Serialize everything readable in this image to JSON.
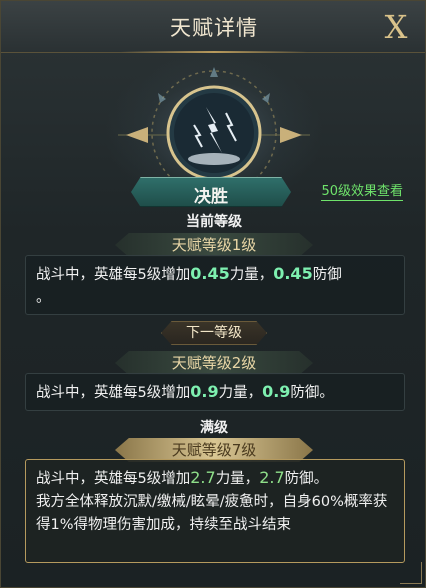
{
  "header": {
    "title": "天赋详情",
    "close_label": "X"
  },
  "talent": {
    "name": "决胜",
    "lv50_link": "50级效果查看"
  },
  "current": {
    "section_label": "当前等级",
    "level_label": "天赋等级1级",
    "desc": [
      "战斗中，英雄每5级增加",
      "0.45",
      "力量，",
      "0.45",
      "防御",
      "。"
    ]
  },
  "next": {
    "section_label": "下一等级",
    "level_label": "天赋等级2级",
    "desc": [
      "战斗中，英雄每5级增加",
      "0.9",
      "力量，",
      "0.9",
      "防御。"
    ]
  },
  "max": {
    "section_label": "满级",
    "level_label": "天赋等级7级",
    "desc": [
      "战斗中，英雄每5级增加",
      "2.7",
      "力量，",
      "2.7",
      "防御。",
      "我方全体释放沉默/缴械/眩晕/疲惫时，自身60%概率获得1%得物理伤害加成，持续至战斗结束"
    ]
  },
  "icons": {
    "emblem": "lightning-talent-icon",
    "close": "close-icon"
  },
  "colors": {
    "highlight": "#7ef0b0",
    "link": "#6fe36b",
    "gold": "#d9c693"
  }
}
